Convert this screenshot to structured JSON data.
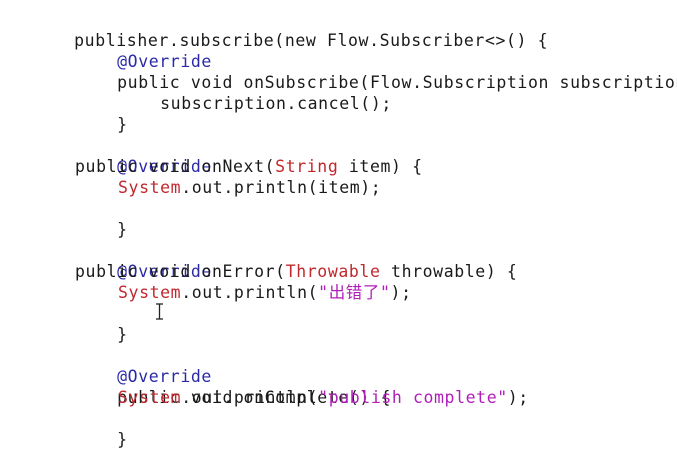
{
  "code": {
    "line1": "publisher.subscribe(new Flow.Subscriber<>() {",
    "line2": "@Override",
    "line3": "public void onSubscribe(Flow.Subscription subscription)",
    "line4": "subscription.cancel();",
    "line5": "}",
    "line7": "@Override",
    "line8a": "public void onNext(",
    "line8b": "String",
    "line8c": " item) {",
    "line9a": "System",
    "line9b": ".out.println(item);",
    "line10": "}",
    "line12": "@Override",
    "line13a": "public void onError(",
    "line13b": "Throwable",
    "line13c": " throwable) {",
    "line14a": "System",
    "line14b": ".out.println(",
    "line14c": "\"出错了\"",
    "line14d": ");",
    "line15": "}",
    "line17": "@Override",
    "line18": "public void onComplete() {",
    "line19a": "System",
    "line19b": ".out.println(",
    "line19c": "\"publish complete\"",
    "line19d": ");",
    "line20": "}",
    "line21": "});"
  },
  "colors": {
    "keyword": "#2a2aa8",
    "annotation": "#2a2aa8",
    "type": "#c0282e",
    "string": "#b01eb8",
    "identifier": "#1a1a1a",
    "background": "#ffffff"
  },
  "icons": {
    "cursor": "i-beam-cursor-icon"
  }
}
